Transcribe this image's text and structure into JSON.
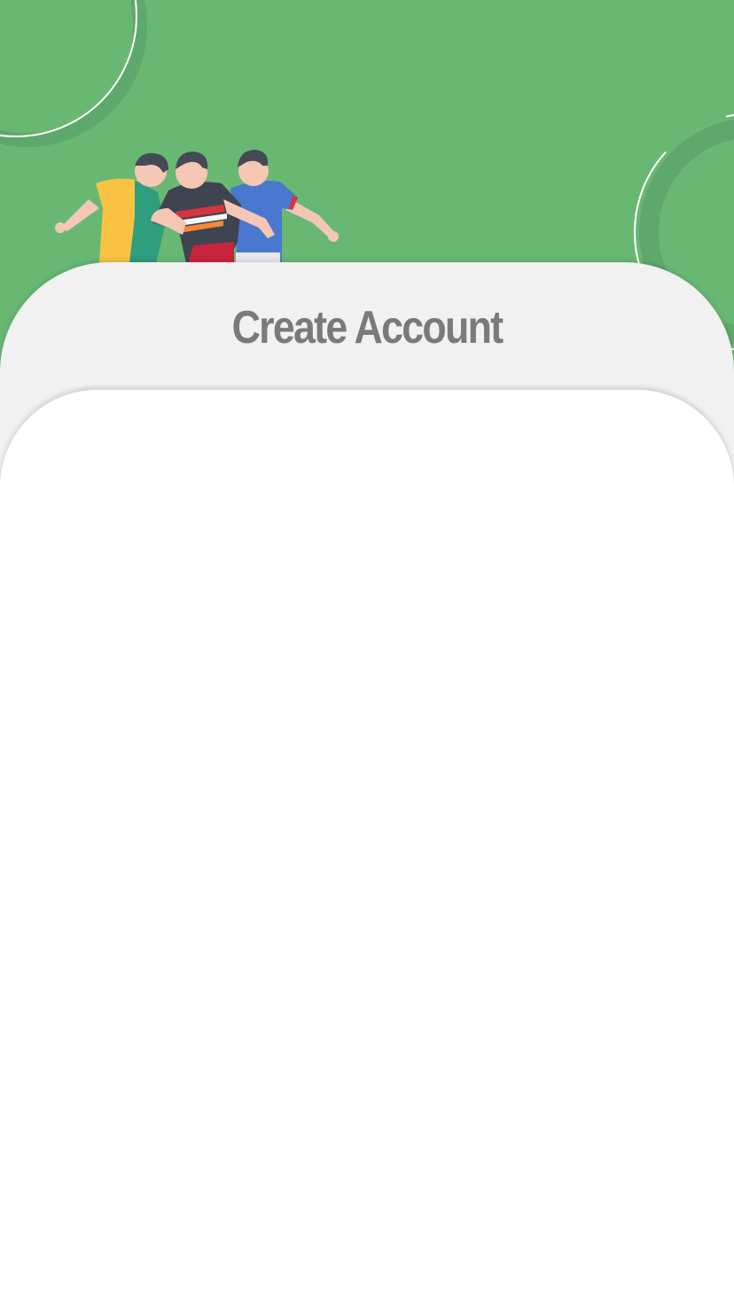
{
  "header": {
    "title": "Create Account",
    "illustration": "three-football-players",
    "background_color": "#68b874"
  },
  "sheet": {
    "background_color": "#f1f1f1"
  },
  "form_card": {
    "background_color": "#ffffff"
  }
}
